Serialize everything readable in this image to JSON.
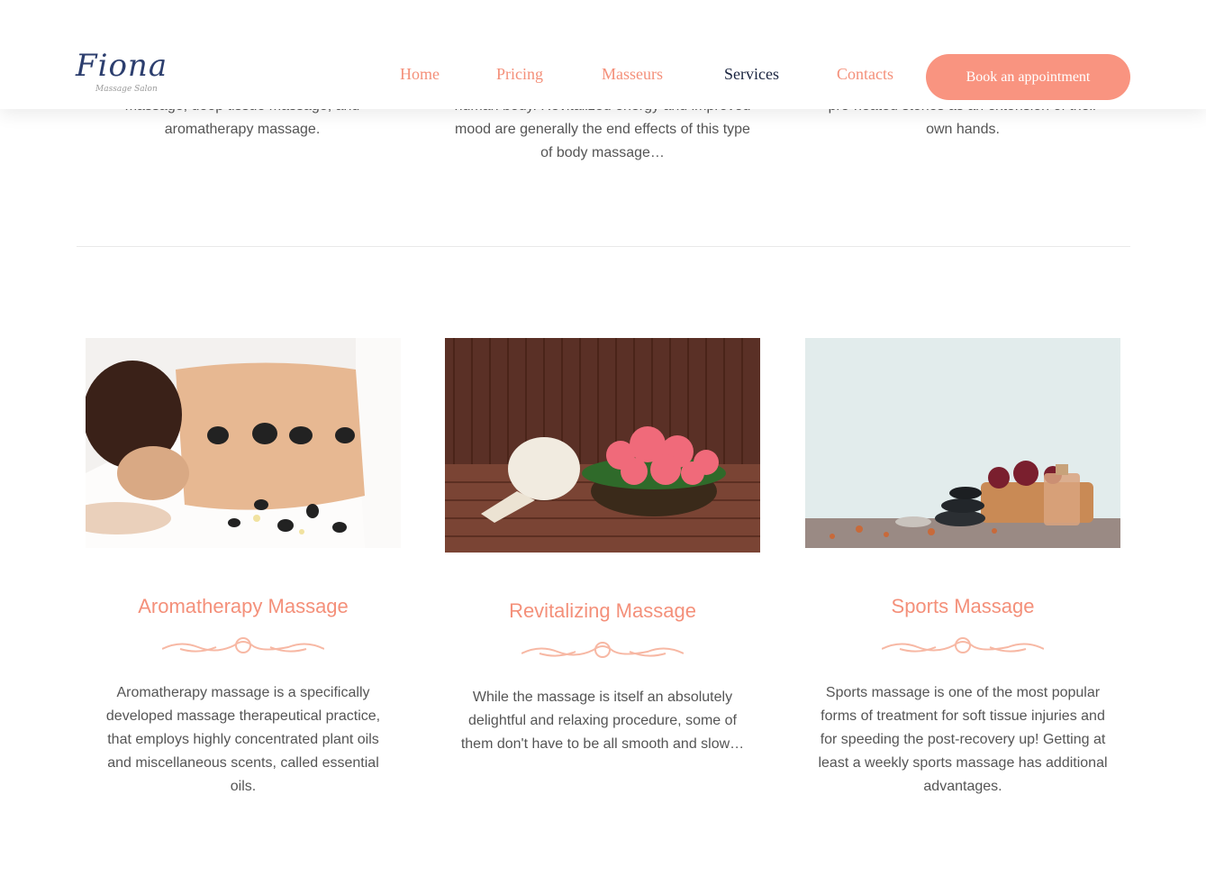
{
  "header": {
    "logo_text": "Fiona",
    "logo_subtitle": "Massage Salon",
    "nav": [
      {
        "label": "Home"
      },
      {
        "label": "Pricing"
      },
      {
        "label": "Masseurs"
      },
      {
        "label": "Services"
      },
      {
        "label": "Contacts"
      }
    ],
    "active_nav": "Services",
    "cta_label": "Book an appointment"
  },
  "previous_row": {
    "col1_line": "massage, deep tissue massage, and",
    "col1_text": "aromatherapy massage.",
    "col2_line": "human body. Revitalized energy and improved",
    "col2_text": "mood are generally the end effects of this type of body massage…",
    "col3_line": "pre-heated stones as an extension of their",
    "col3_text": "own hands."
  },
  "services": [
    {
      "title": "Aromatherapy Massage",
      "description": "Aromatherapy massage is a specifically developed massage therapeutical practice, that employs highly concentrated plant oils and miscellaneous scents, called essential oils."
    },
    {
      "title": "Revitalizing Massage",
      "description": "While the massage is itself an absolutely delightful and relaxing procedure, some of them don't have to be all smooth and slow…"
    },
    {
      "title": "Sports Massage",
      "description": "Sports massage is one of the most popular forms of treatment for soft tissue injuries and for speeding the post-recovery up! Getting at least a weekly sports massage has additional advantages."
    }
  ],
  "colors": {
    "accent": "#f4907a",
    "button": "#f99480",
    "nav_active": "#1b2540",
    "text": "#555555"
  }
}
